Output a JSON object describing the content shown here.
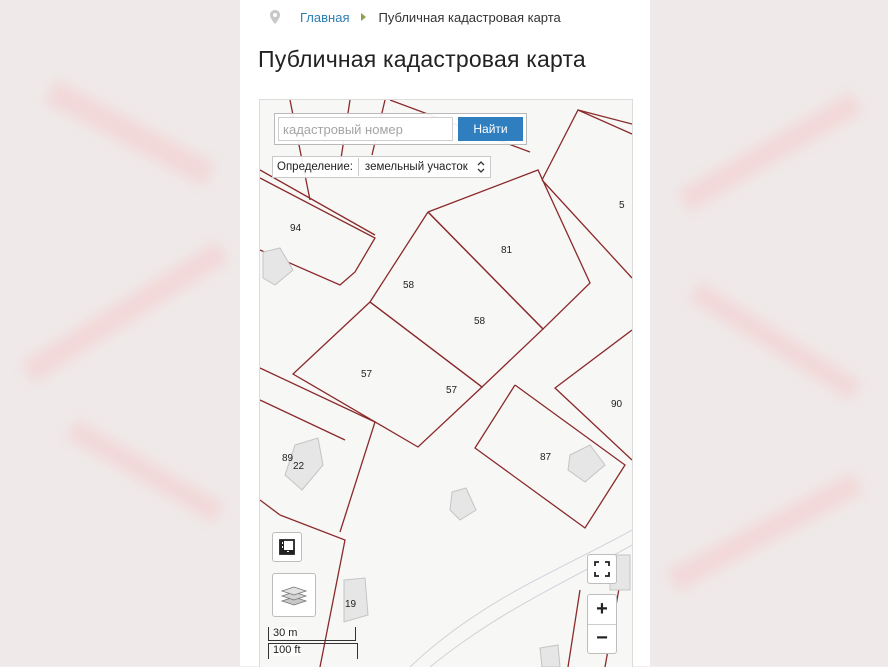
{
  "breadcrumb": {
    "home": "Главная",
    "current": "Публичная кадастровая карта"
  },
  "page_title": "Публичная кадастровая карта",
  "search": {
    "placeholder": "кадастровый номер",
    "value": "",
    "button_label": "Найти"
  },
  "definition": {
    "label": "Определение:",
    "selected": "земельный участок"
  },
  "parcels": {
    "p94": "94",
    "p81": "81",
    "p58a": "58",
    "p58b": "58",
    "p57a": "57",
    "p57b": "57",
    "p90": "90",
    "p87": "87",
    "p89": "89",
    "p22": "22",
    "p19": "19",
    "p5": "5"
  },
  "scale": {
    "metric": "30 m",
    "imperial": "100 ft"
  },
  "controls": {
    "zoom_in": "+",
    "zoom_out": "−"
  },
  "colors": {
    "parcel_border": "#8a2a2a",
    "button_blue": "#2f7fc0",
    "link_blue": "#2d7db3"
  }
}
